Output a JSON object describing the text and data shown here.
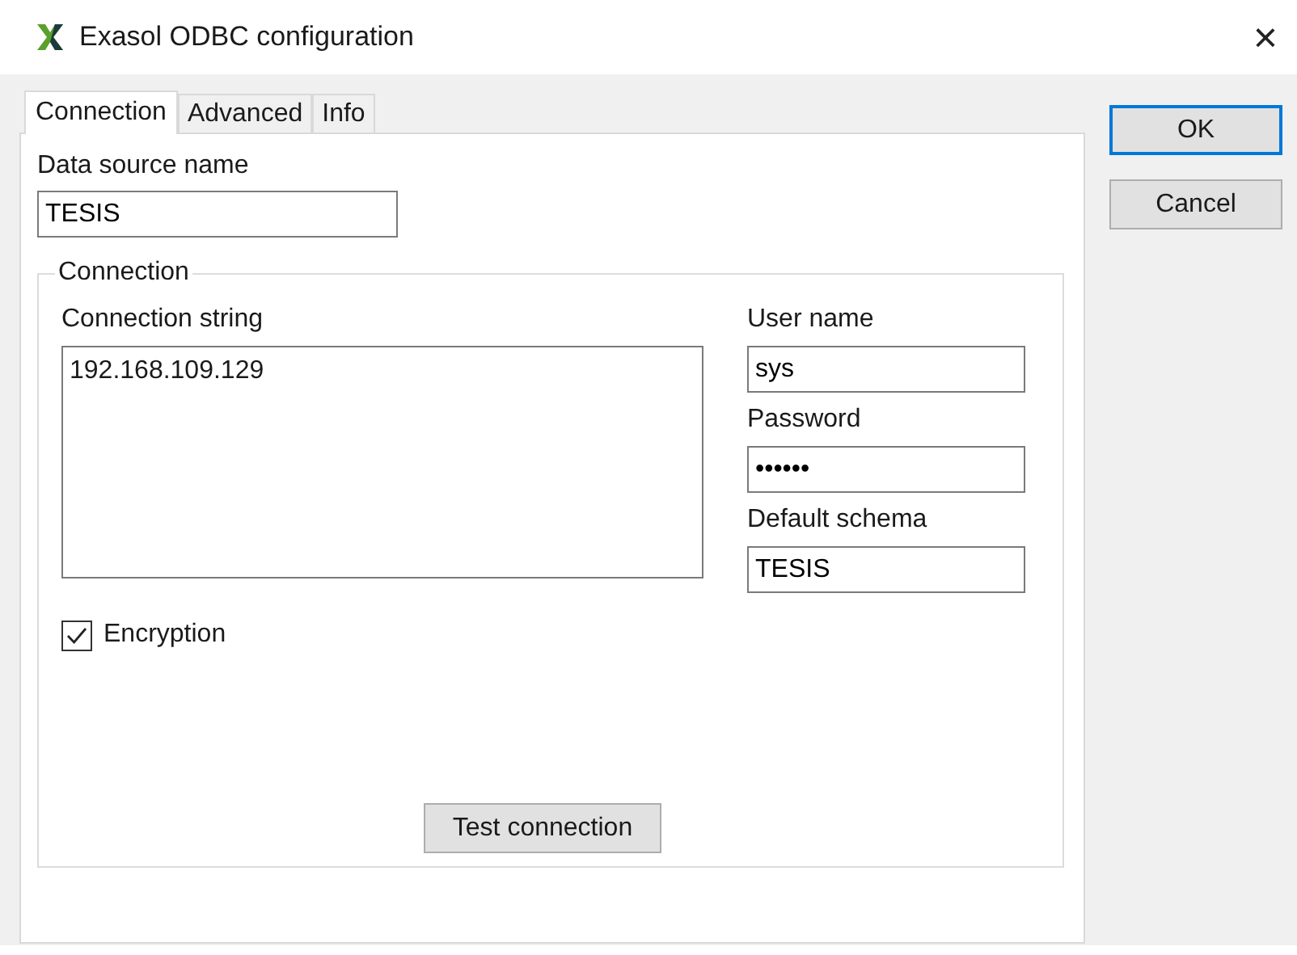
{
  "window": {
    "title": "Exasol ODBC configuration",
    "close": "×"
  },
  "tabs": [
    {
      "label": "Connection",
      "selected": true
    },
    {
      "label": "Advanced",
      "selected": false
    },
    {
      "label": "Info",
      "selected": false
    }
  ],
  "data_source_name": {
    "label": "Data source name",
    "value": "TESIS"
  },
  "connection_group": {
    "title": "Connection",
    "connection_string": {
      "label": "Connection string",
      "value": "192.168.109.129"
    },
    "user_name": {
      "label": "User name",
      "value": "sys"
    },
    "password": {
      "label": "Password",
      "value": "••••••"
    },
    "default_schema": {
      "label": "Default schema",
      "value": "TESIS"
    },
    "encryption": {
      "label": "Encryption",
      "checked": true
    },
    "test_button": "Test connection"
  },
  "buttons": [
    {
      "label": "OK",
      "default": true
    },
    {
      "label": "Cancel",
      "default": false
    }
  ]
}
